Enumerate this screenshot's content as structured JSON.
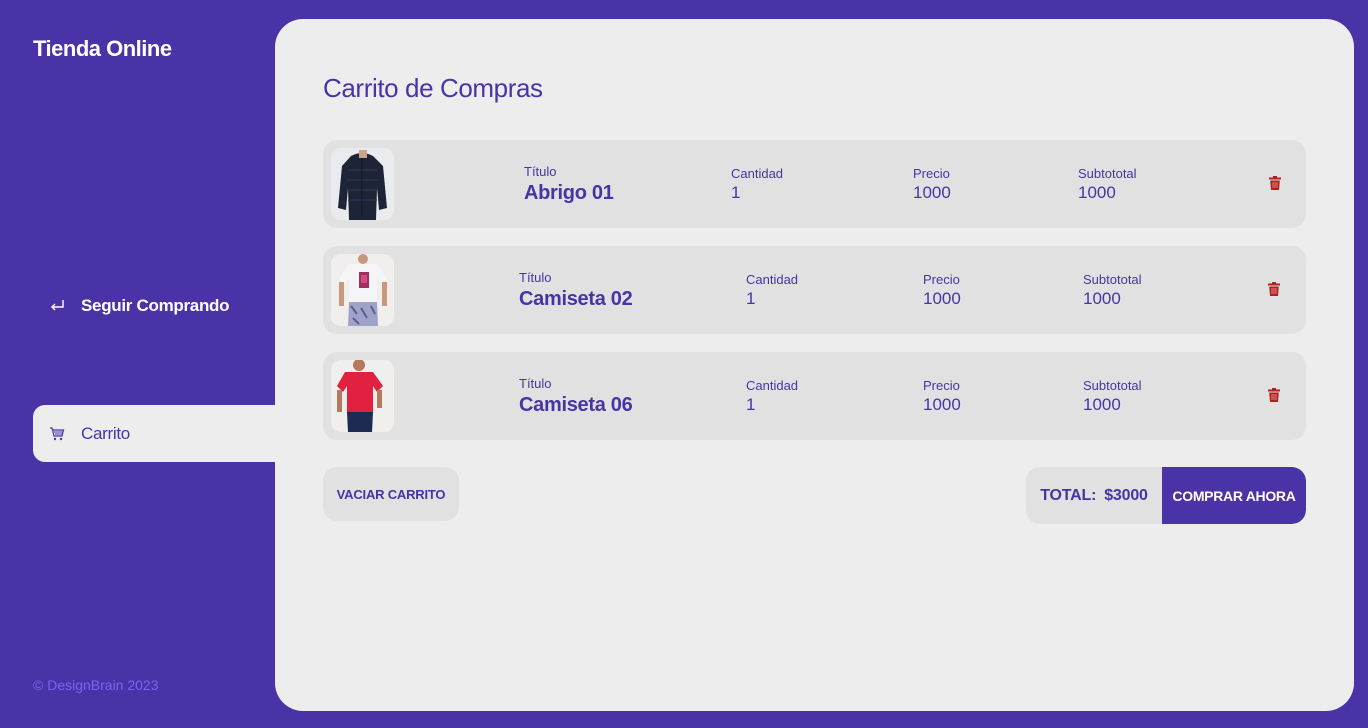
{
  "sidebar": {
    "brand": "Tienda Online",
    "items": [
      {
        "label": "Seguir Comprando",
        "icon": "return-arrow-icon"
      },
      {
        "label": "Carrito",
        "icon": "cart-icon",
        "active": true
      }
    ],
    "copyright": "© DesignBrain 2023"
  },
  "main": {
    "title": "Carrito de Compras",
    "labels": {
      "titulo": "Título",
      "cantidad": "Cantidad",
      "precio": "Precio",
      "subtotal": "Subtototal"
    },
    "items": [
      {
        "title": "Abrigo 01",
        "quantity": "1",
        "price": "1000",
        "subtotal": "1000",
        "image": "dark-puffer-jacket"
      },
      {
        "title": "Camiseta 02",
        "quantity": "1",
        "price": "1000",
        "subtotal": "1000",
        "image": "white-graphic-tshirt"
      },
      {
        "title": "Camiseta 06",
        "quantity": "1",
        "price": "1000",
        "subtotal": "1000",
        "image": "red-tshirt"
      }
    ],
    "clear_label": "VACIAR CARRITO",
    "total_label": "TOTAL:",
    "total_value": "$3000",
    "buy_label": "COMPRAR AHORA"
  },
  "colors": {
    "primary": "#4a33a6",
    "panel": "#ededed",
    "card": "#e1e1e1",
    "delete": "#b0201f"
  }
}
